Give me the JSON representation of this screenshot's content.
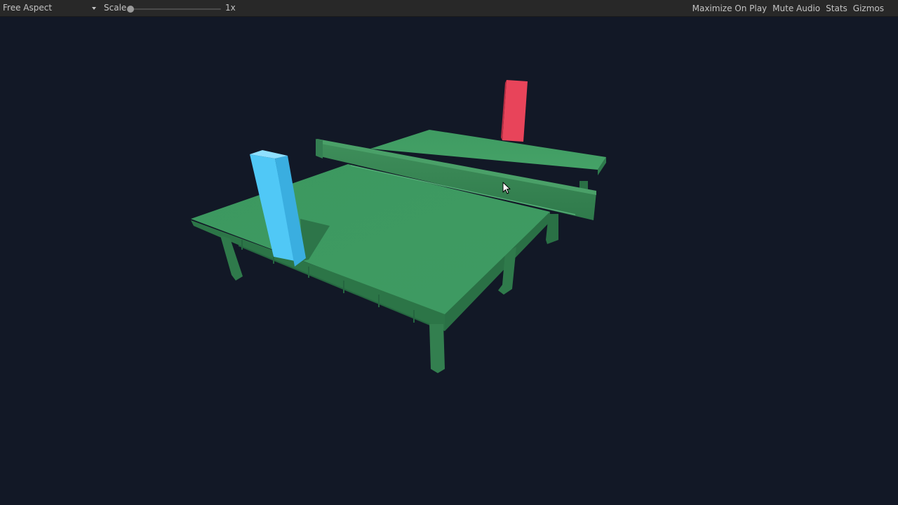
{
  "toolbar": {
    "aspect": "Free Aspect",
    "scale_label": "Scale",
    "scale_value": "1x",
    "maximize_label": "Maximize On Play",
    "mute_label": "Mute Audio",
    "stats_label": "Stats",
    "gizmos_label": "Gizmos"
  },
  "scene": {
    "background_color": "#121826",
    "table_color": "#3f9b62",
    "player_left_paddle_color": "#48c4f4",
    "player_right_paddle_color": "#e8445a"
  },
  "icons": {
    "aspect_dropdown": "chevron-down-icon",
    "cursor": "mouse-pointer-icon"
  }
}
